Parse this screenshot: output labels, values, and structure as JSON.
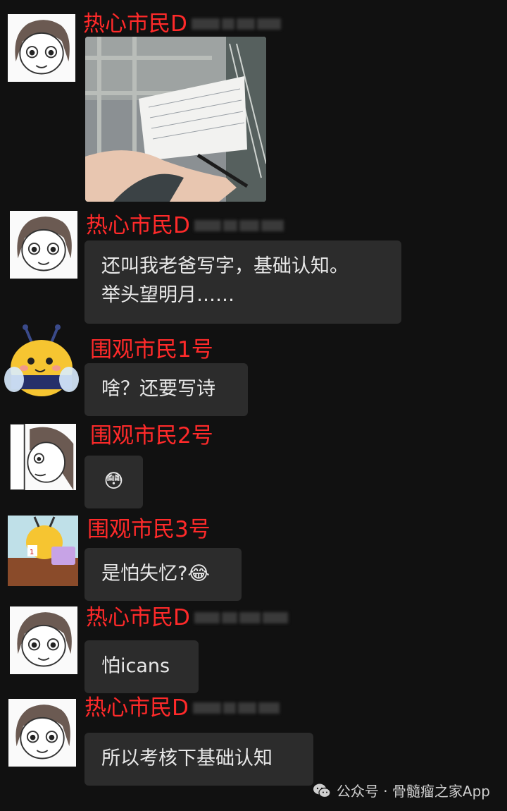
{
  "messages": [
    {
      "sender": "热心市民D",
      "type": "image"
    },
    {
      "sender": "热心市民D",
      "type": "text",
      "lines": [
        "还叫我老爸写字，基础认知。",
        "举头望明月……"
      ]
    },
    {
      "sender": "围观市民1号",
      "type": "text",
      "text": "啥？还要写诗"
    },
    {
      "sender": "围观市民2号",
      "type": "emoji",
      "text": "😳"
    },
    {
      "sender": "围观市民3号",
      "type": "text",
      "text": "是怕失忆?",
      "emoji": "😂"
    },
    {
      "sender": "热心市民D",
      "type": "text",
      "text": "怕icans"
    },
    {
      "sender": "热心市民D",
      "type": "text",
      "text": "所以考核下基础认知"
    }
  ],
  "footer": {
    "label": "公众号 · 骨髓瘤之家App",
    "icon": "wechat-icon"
  },
  "colors": {
    "background": "#111111",
    "bubble": "#2c2c2c",
    "name": "#ff2a2a"
  }
}
